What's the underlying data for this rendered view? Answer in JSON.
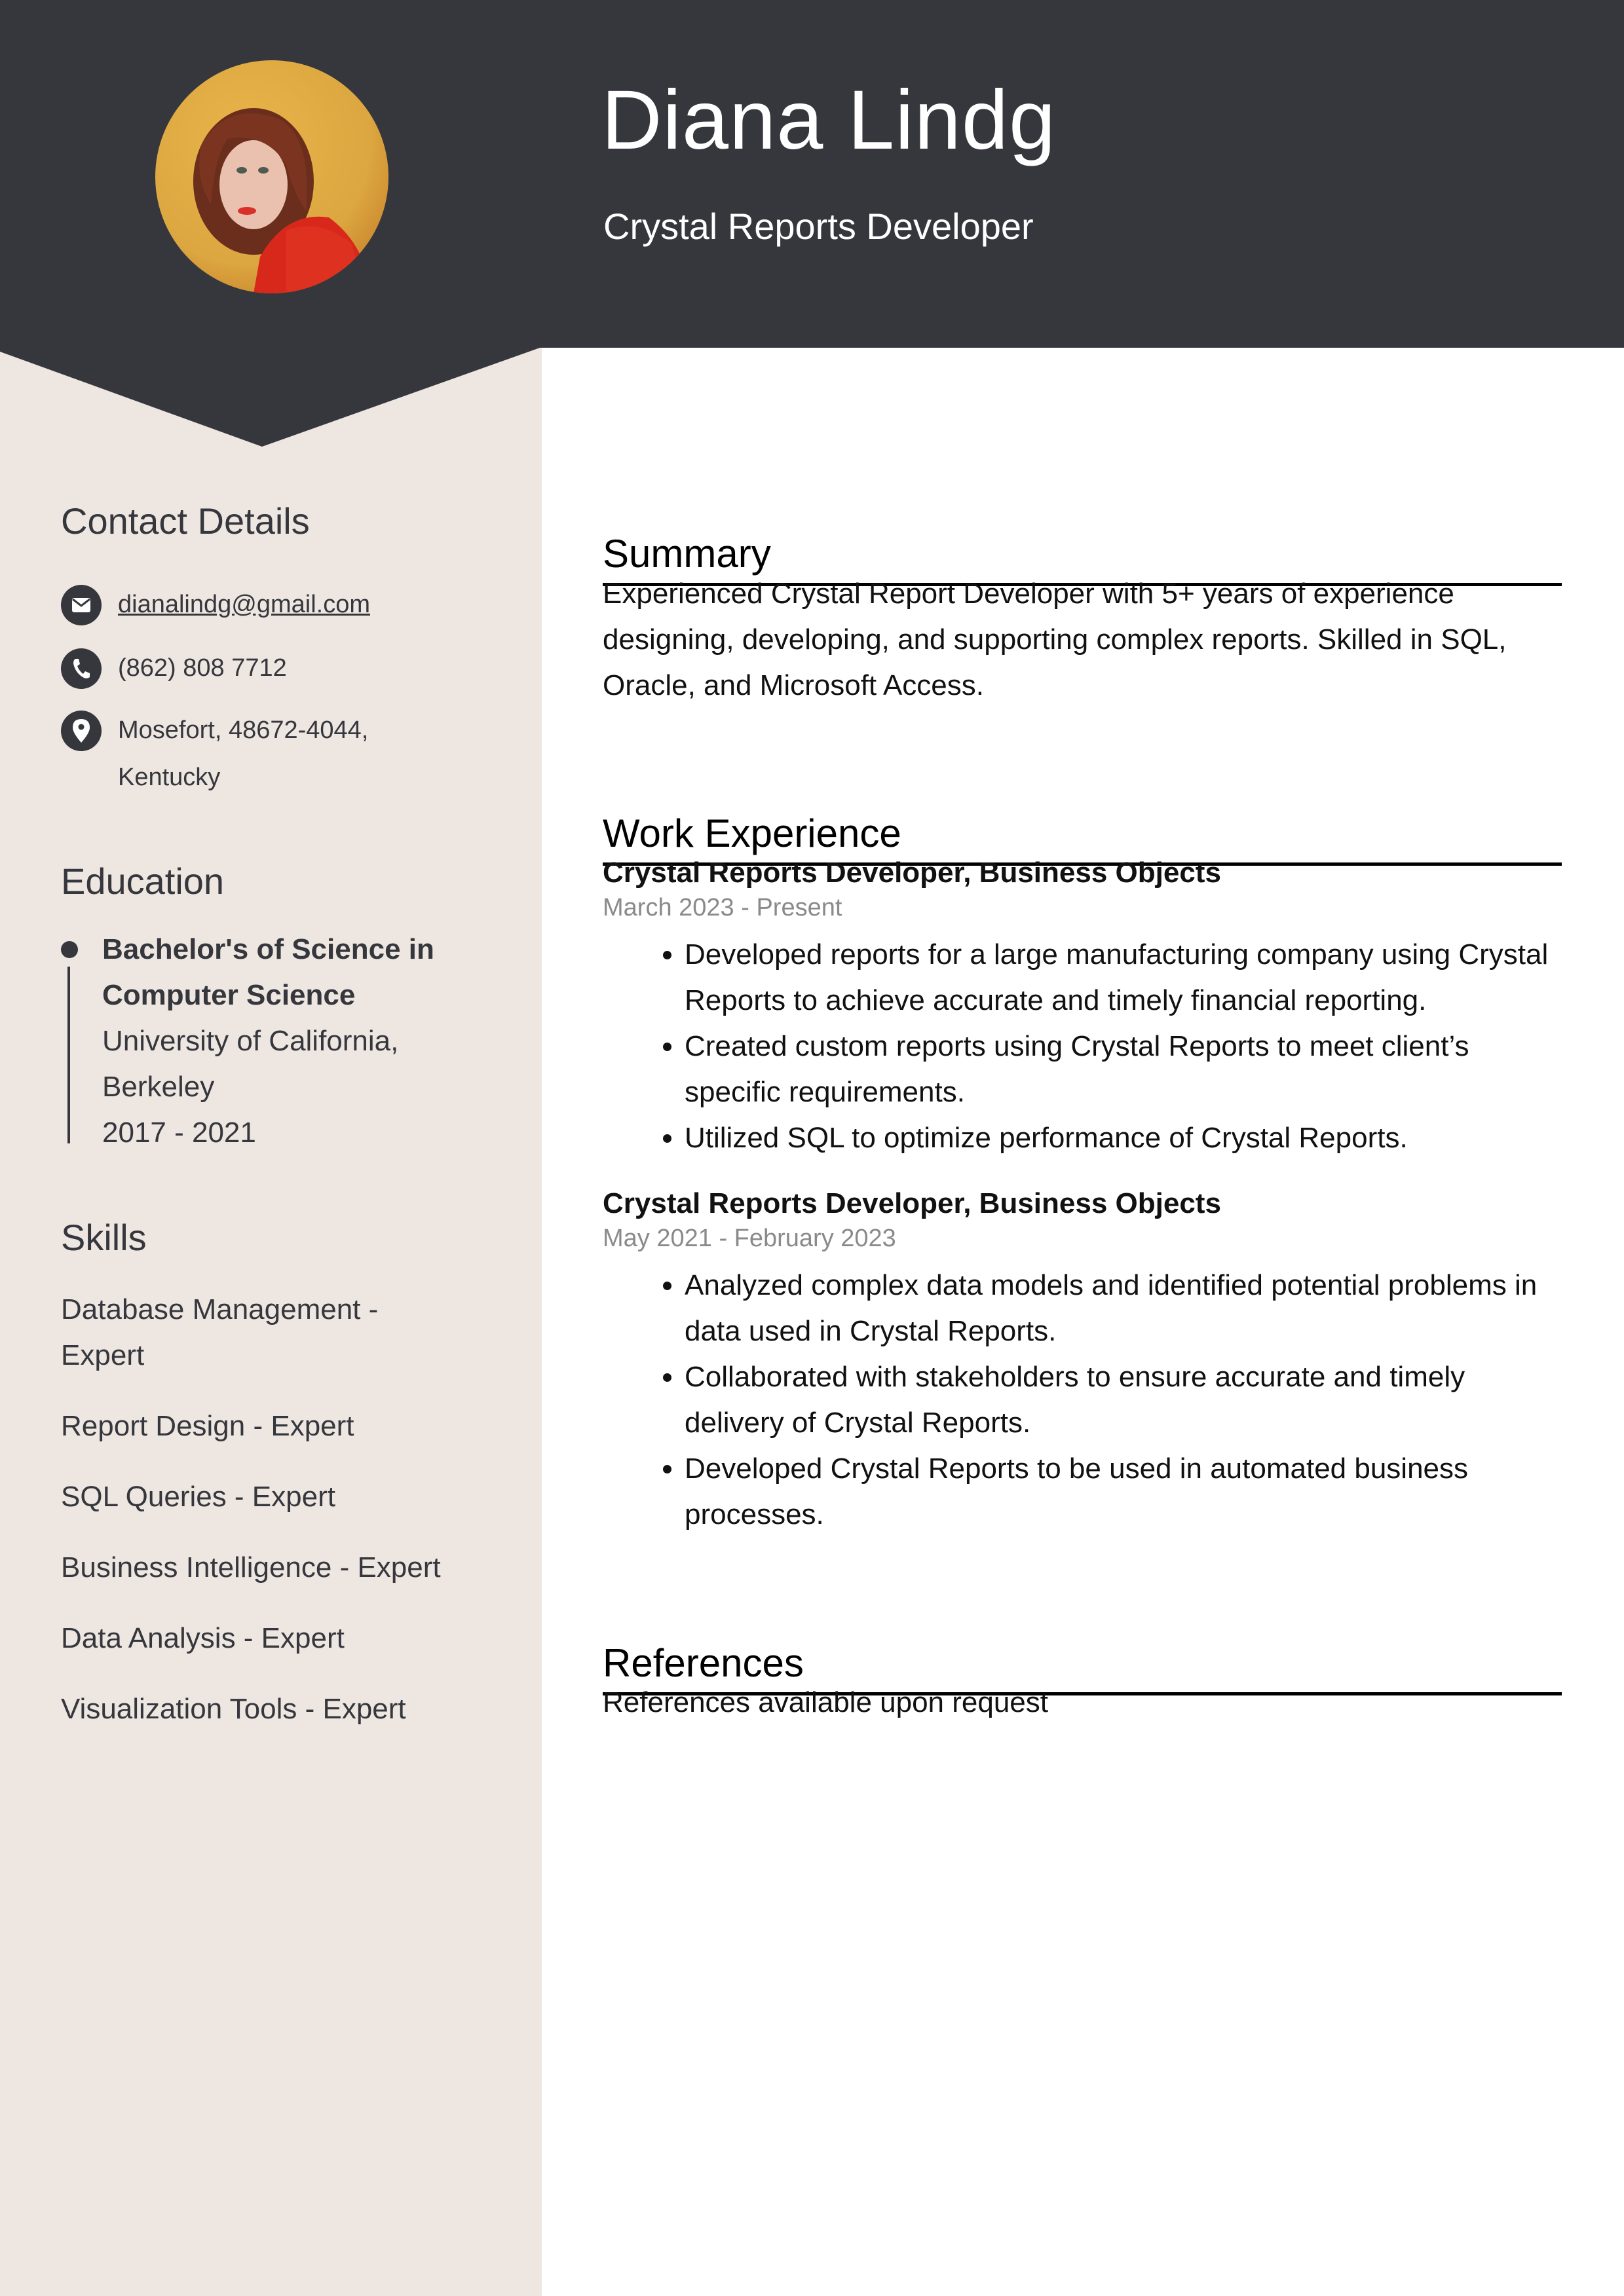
{
  "header": {
    "name": "Diana Lindg",
    "title": "Crystal Reports Developer",
    "photo_alt": "profile-photo"
  },
  "colors": {
    "header_bg": "#36373d",
    "sidebar_bg": "#ede6e1",
    "text_dark": "#36373d",
    "date_gray": "#8a8a8a"
  },
  "sidebar": {
    "contact": {
      "heading": "Contact Details",
      "email": "dianalindg@gmail.com",
      "phone": "(862) 808 7712",
      "address_line1": "Mosefort, 48672-4044,",
      "address_line2": "Kentucky"
    },
    "education": {
      "heading": "Education",
      "entries": [
        {
          "degree_line1": "Bachelor's of Science in",
          "degree_line2": "Computer Science",
          "school_line1": "University of California,",
          "school_line2": "Berkeley",
          "years": "2017 - 2021"
        }
      ]
    },
    "skills": {
      "heading": "Skills",
      "items": [
        {
          "line1": "Database Management -",
          "line2": "Expert"
        },
        {
          "line1": "Report Design - Expert"
        },
        {
          "line1": "SQL Queries - Expert"
        },
        {
          "line1": "Business Intelligence - Expert"
        },
        {
          "line1": "Data Analysis - Expert"
        },
        {
          "line1": "Visualization Tools - Expert"
        }
      ]
    }
  },
  "main": {
    "summary": {
      "heading": "Summary",
      "text": "Experienced Crystal Report Developer with 5+ years of experience designing, developing, and supporting complex reports. Skilled in SQL, Oracle, and Microsoft Access."
    },
    "experience": {
      "heading": "Work Experience",
      "jobs": [
        {
          "title": "Crystal Reports Developer, Business Objects",
          "dates": "March 2023 - Present",
          "bullets": [
            "Developed reports for a large manufacturing company using Crystal Reports to achieve accurate and timely financial reporting.",
            "Created custom reports using Crystal Reports to meet client’s specific requirements.",
            "Utilized SQL to optimize performance of Crystal Reports."
          ]
        },
        {
          "title": "Crystal Reports Developer, Business Objects",
          "dates": "May 2021 - February 2023",
          "bullets": [
            "Analyzed complex data models and identified potential problems in data used in Crystal Reports.",
            "Collaborated with stakeholders to ensure accurate and timely delivery of Crystal Reports.",
            "Developed Crystal Reports to be used in automated business processes."
          ]
        }
      ]
    },
    "references": {
      "heading": "References",
      "text": "References available upon request"
    }
  }
}
